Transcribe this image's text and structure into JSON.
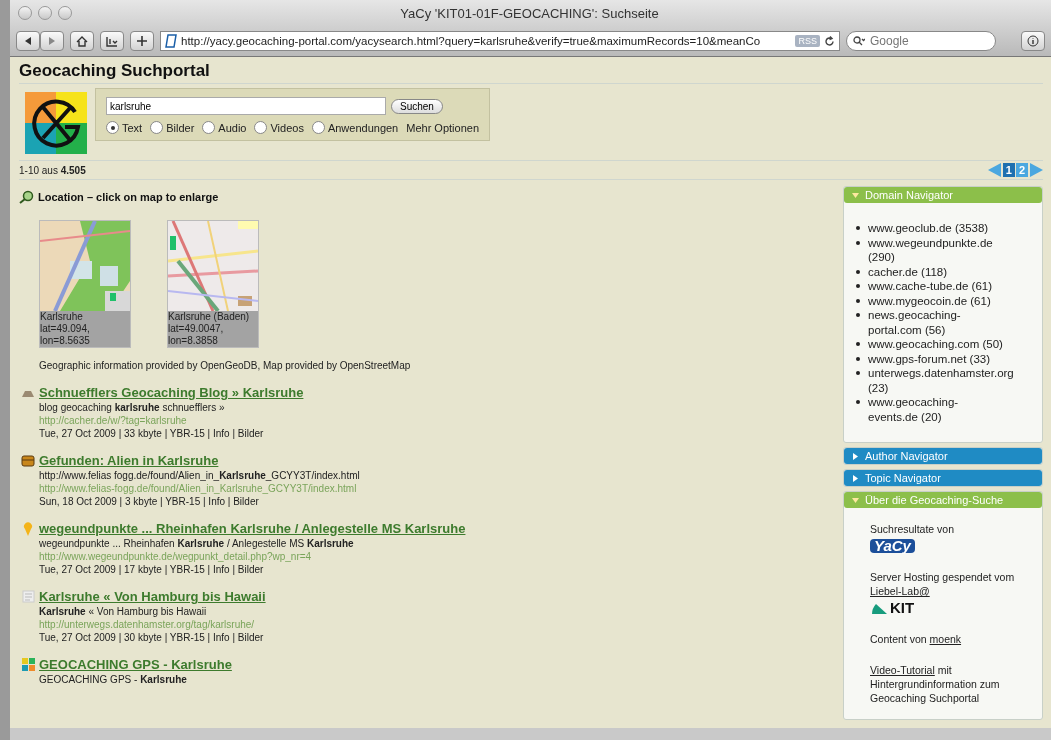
{
  "window": {
    "title": "YaCy 'KIT01-01F-GEOCACHING': Suchseite"
  },
  "toolbar": {
    "url": "http://yacy.geocaching-portal.com/yacysearch.html?query=karlsruhe&verify=true&maximumRecords=10&meanCo",
    "rss": "RSS",
    "search_placeholder": "Google"
  },
  "page": {
    "heading": "Geocaching Suchportal",
    "search": {
      "value": "karlsruhe",
      "button": "Suchen",
      "types": [
        {
          "label": "Text",
          "selected": true
        },
        {
          "label": "Bilder",
          "selected": false
        },
        {
          "label": "Audio",
          "selected": false
        },
        {
          "label": "Videos",
          "selected": false
        },
        {
          "label": "Anwendungen",
          "selected": false
        }
      ],
      "more": "Mehr Optionen"
    },
    "result_count": "1-10 aus **4.505**",
    "pagination": [
      {
        "label": "1",
        "selected": true
      },
      {
        "label": "2",
        "selected": false
      }
    ],
    "location": {
      "title": "Location – click on map to enlarge",
      "maps": [
        {
          "lines": [
            "Karlsruhe",
            "lat=49.094,",
            "lon=8.5635"
          ]
        },
        {
          "lines": [
            "Karlsruhe (Baden)",
            "lat=49.0047,",
            "lon=8.3858"
          ]
        }
      ],
      "credit": "Geographic information provided by OpenGeoDB, Map provided by OpenStreetMap"
    },
    "results": [
      {
        "title": "Schnuefflers Geocaching Blog » Karlsruhe",
        "snippet": "blog geocaching **karlsruhe** schnuefflers »",
        "url": "http://cacher.de/w/?tag=karlsruhe",
        "meta": "Tue, 27 Oct 2009 | 33 kbyte | YBR-15 | Info | Bilder"
      },
      {
        "title": "Gefunden: Alien in Karlsruhe",
        "snippet": "http://www.felias fogg.de/found/Alien_in_**Karlsruhe**_GCYY3T/index.html",
        "url": "http://www.felias-fogg.de/found/Alien_in_Karlsruhe_GCYY3T/index.html",
        "meta": "Sun, 18 Oct 2009 | 3 kbyte | YBR-15 | Info | Bilder"
      },
      {
        "title": "wegeundpunkte ... Rheinhafen Karlsruhe / Anlegestelle MS Karlsruhe",
        "snippet": "wegeundpunkte ... Rheinhafen **Karlsruhe** / Anlegestelle MS **Karlsruhe**",
        "url": "http://www.wegeundpunkte.de/wegpunkt_detail.php?wp_nr=4",
        "meta": "Tue, 27 Oct 2009 | 17 kbyte | YBR-15 | Info | Bilder"
      },
      {
        "title": "Karlsruhe « Von Hamburg bis Hawaii",
        "snippet": "**Karlsruhe** « Von Hamburg bis Hawaii",
        "url": "http://unterwegs.datenhamster.org/tag/karlsruhe/",
        "meta": "Tue, 27 Oct 2009 | 30 kbyte | YBR-15 | Info | Bilder"
      },
      {
        "title": "GEOCACHING GPS - Karlsruhe",
        "snippet": "GEOCACHING GPS - **Karlsruhe**"
      }
    ]
  },
  "sidebar": {
    "panels": [
      {
        "kind": "list",
        "title": "Domain Navigator",
        "expanded": true,
        "color": "#8cbf4a",
        "items": [
          "www.geoclub.de (3538)",
          "www.wegeundpunkte.de (290)",
          "cacher.de (118)",
          "www.cache-tube.de (61)",
          "www.mygeocoin.de (61)",
          "news.geocaching-portal.com (56)",
          "www.geocaching.com (50)",
          "www.gps-forum.net (33)",
          "unterwegs.datenhamster.org (23)",
          "www.geocaching-events.de (20)"
        ]
      },
      {
        "title": "Author Navigator",
        "expanded": false,
        "color": "#1f8bc4"
      },
      {
        "title": "Topic Navigator",
        "expanded": false,
        "color": "#1f8bc4"
      },
      {
        "kind": "about",
        "title": "Über die Geocaching-Suche",
        "expanded": true,
        "color": "#8cbf4a",
        "results_by": "Suchresultate von",
        "yacy_logo": "YaCy",
        "hosting": "Server Hosting gespendet vom",
        "hosting_link": "Liebel-Lab@",
        "kit_logo": "KIT",
        "content": "Content von",
        "content_link": "moenk",
        "video_link": "Video-Tutorial",
        "video_text": "mit Hintergrundinformation zum Geocaching Suchportal"
      }
    ]
  }
}
